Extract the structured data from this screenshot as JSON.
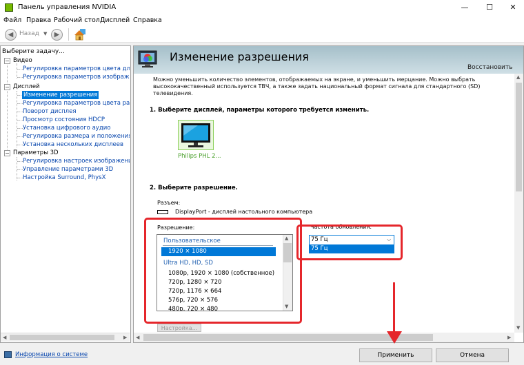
{
  "window": {
    "title": "Панель управления NVIDIA",
    "minimize": "—",
    "maximize": "☐",
    "close": "✕"
  },
  "menu": [
    "Файл",
    "Правка",
    "Рабочий стол",
    "Дисплей",
    "Справка"
  ],
  "toolbar": {
    "back_label": "Назад"
  },
  "sidebar": {
    "title": "Выберите задачу...",
    "tree": [
      {
        "text": "Видео",
        "kind": "cat"
      },
      {
        "text": "Регулировка параметров цвета для вид",
        "kind": "link"
      },
      {
        "text": "Регулировка параметров изображения д",
        "kind": "link"
      },
      {
        "text": "Дисплей",
        "kind": "cat"
      },
      {
        "text": "Изменение разрешения",
        "kind": "sel"
      },
      {
        "text": "Регулировка параметров цвета рабочег",
        "kind": "link"
      },
      {
        "text": "Поворот дисплея",
        "kind": "link"
      },
      {
        "text": "Просмотр состояния HDCP",
        "kind": "link"
      },
      {
        "text": "Установка цифрового аудио",
        "kind": "link"
      },
      {
        "text": "Регулировка размера и положения рабоч",
        "kind": "link"
      },
      {
        "text": "Установка нескольких дисплеев",
        "kind": "link"
      },
      {
        "text": "Параметры 3D",
        "kind": "cat"
      },
      {
        "text": "Регулировка настроек изображения с пр",
        "kind": "link"
      },
      {
        "text": "Управление параметрами 3D",
        "kind": "link"
      },
      {
        "text": "Настройка Surround, PhysX",
        "kind": "link"
      }
    ]
  },
  "content": {
    "title": "Изменение разрешения",
    "restore": "Восстановить",
    "description": "Можно уменьшить количество элементов, отображаемых на экране, и уменьшить мерцание. Можно выбрать высококачественный используется ТВЧ, а также задать национальный формат сигнала для стандартного (SD) телевидения.",
    "step1_title": "1. Выберите дисплей, параметры которого требуется изменить.",
    "display_name": "Philips PHL 2...",
    "step2_title": "2. Выберите разрешение.",
    "connector_label": "Разъем:",
    "connector_value": "DisplayPort - дисплей настольного компьютера",
    "resolution_label": "Разрешение:",
    "resolutions": [
      {
        "text": "Пользовательское",
        "kind": "group"
      },
      {
        "text": "1920 × 1080",
        "kind": "sel"
      },
      {
        "text": "Ultra HD, HD, SD",
        "kind": "group"
      },
      {
        "text": "1080p, 1920 × 1080 (собственное)",
        "kind": "opt"
      },
      {
        "text": "720p, 1280 × 720",
        "kind": "opt"
      },
      {
        "text": "720p, 1176 × 664",
        "kind": "opt"
      },
      {
        "text": "576p, 720 × 576",
        "kind": "opt"
      },
      {
        "text": "480p, 720 × 480",
        "kind": "opt"
      }
    ],
    "refresh_label": "Частота обновления:",
    "refresh_value": "75 Гц",
    "refresh_option": "75 Гц",
    "config_button": "Настройка..."
  },
  "status": {
    "sysinfo": "Информация о системе"
  },
  "buttons": {
    "apply": "Применить",
    "cancel": "Отмена"
  },
  "colors": {
    "highlight": "#e5262b",
    "selection": "#0078d7",
    "nvidia_green": "#76b900"
  }
}
